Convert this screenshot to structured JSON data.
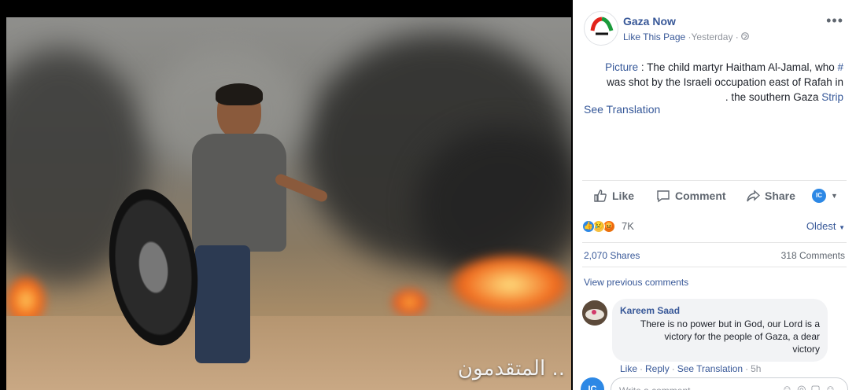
{
  "post": {
    "page_name": "Gaza Now",
    "like_page": "Like This Page",
    "time": "·Yesterday ·",
    "more_icon": "•••",
    "text_line1_link": "Picture",
    "text_line1_rest": " : The child martyr Haitham Al-Jamal, who ",
    "text_line1_hashtag": "#",
    "text_line2": "was shot by the Israeli occupation east of Rafah in",
    "text_line3_prefix": ". the southern Gaza ",
    "text_line3_link": "Strip",
    "see_translation": "See Translation",
    "photo_caption": "المتقدمون .."
  },
  "actions": {
    "like": "Like",
    "comment": "Comment",
    "share": "Share",
    "profile_initials": "IC"
  },
  "reactions": {
    "count": "7K",
    "sort": "Oldest",
    "shares": "2,070 Shares",
    "comments": "318 Comments"
  },
  "comments": {
    "view_previous": "View previous comments",
    "items": [
      {
        "author": "Kareem Saad",
        "line1": "There is no power but in God, our Lord is a",
        "line2": "victory for the people of Gaza, a dear",
        "line3": "victory",
        "like": "Like",
        "reply": "Reply",
        "see_translation": "See Translation",
        "time": "5h"
      }
    ],
    "write_placeholder": "Write a comment...",
    "writer_initials": "IC"
  },
  "colors": {
    "link": "#385898",
    "muted": "#90949c",
    "like_blue": "#2d88e5",
    "angry_red": "#e9710f"
  },
  "icons": [
    "globe-icon",
    "thumbs-up-icon",
    "comment-icon",
    "share-icon",
    "chevron-down-icon",
    "sad-reaction-icon",
    "angry-reaction-icon",
    "like-reaction-icon",
    "emoji-icon",
    "camera-icon",
    "gif-icon",
    "sticker-icon"
  ]
}
